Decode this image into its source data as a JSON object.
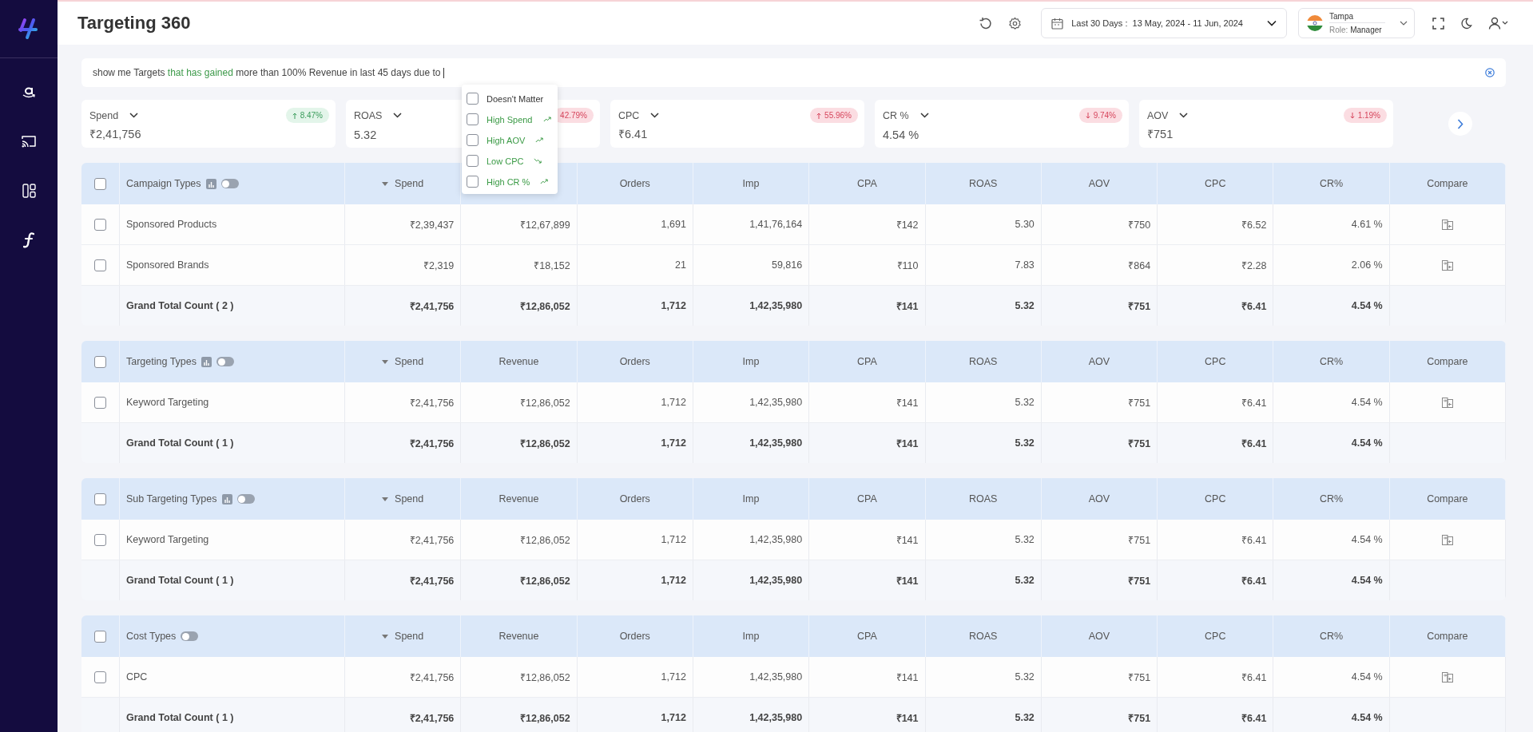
{
  "sidebar": {
    "items": [
      {
        "kind": "amazon"
      },
      {
        "kind": "cast"
      },
      {
        "kind": "dashboard"
      },
      {
        "kind": "function"
      }
    ]
  },
  "header": {
    "title": "Targeting 360",
    "date_range": "Last 30 Days :  13 May, 2024 - 11 Jun, 2024",
    "location": "Tampa",
    "role_label": "Role:",
    "role": "Manager"
  },
  "query": {
    "segments": [
      {
        "text": "show me Targets ",
        "highlight": false
      },
      {
        "text": "that has gained",
        "highlight": true
      },
      {
        "text": " more than 100% Revenue in last 45 days due to",
        "highlight": false
      }
    ]
  },
  "suggestions": [
    {
      "label": "Doesn't Matter",
      "checked": false
    },
    {
      "label": "High Spend",
      "checked": false,
      "rising": true
    },
    {
      "label": "High AOV",
      "checked": false,
      "rising": true
    },
    {
      "label": "Low CPC",
      "checked": false,
      "rising": false
    },
    {
      "label": "High CR %",
      "checked": false,
      "rising": true
    }
  ],
  "kpis": [
    {
      "label": "Spend",
      "value": "₹2,41,756",
      "change": "8.47%",
      "rising": true,
      "positive": true
    },
    {
      "label": "ROAS",
      "value": "5.32",
      "change": "42.79%",
      "positive": false
    },
    {
      "label": "CPC",
      "value": "₹6.41",
      "change": "55.96%",
      "rising": true,
      "positive": false
    },
    {
      "label": "CR %",
      "value": "4.54 %",
      "change": "9.74%",
      "rising": false,
      "positive": false
    },
    {
      "label": "AOV",
      "value": "₹751",
      "change": "1.19%",
      "rising": false,
      "positive": false
    }
  ],
  "tables": [
    {
      "title": "Campaign Types",
      "chart_icon": true,
      "toggle_on": false,
      "all_checked": false,
      "columns": [
        {
          "label": "Spend",
          "sorted": true
        },
        {},
        {
          "label": "Orders"
        },
        {
          "label": "Imp"
        },
        {
          "label": "CPA"
        },
        {
          "label": "ROAS"
        },
        {
          "label": "AOV"
        },
        {
          "label": "CPC"
        },
        {
          "label": "CR%"
        },
        {
          "label": "Compare"
        }
      ],
      "rows": [
        {
          "kind": "data",
          "checked": false,
          "name": "Sponsored Products",
          "values": [
            "₹2,39,437",
            "₹12,67,899",
            "1,691",
            "1,41,76,164",
            "₹142",
            "5.30",
            "₹750",
            "₹6.52",
            "4.61 %"
          ]
        },
        {
          "kind": "data",
          "checked": false,
          "name": "Sponsored Brands",
          "values": [
            "₹2,319",
            "₹18,152",
            "21",
            "59,816",
            "₹110",
            "7.83",
            "₹864",
            "₹2.28",
            "2.06 %"
          ]
        },
        {
          "kind": "total",
          "name": "Grand Total Count ( 2 )",
          "values": [
            "₹2,41,756",
            "₹12,86,052",
            "1,712",
            "1,42,35,980",
            "₹141",
            "5.32",
            "₹751",
            "₹6.41",
            "4.54 %"
          ]
        }
      ]
    },
    {
      "title": "Targeting Types",
      "chart_icon": true,
      "toggle_on": false,
      "all_checked": false,
      "columns": [
        {
          "label": "Spend",
          "sorted": true
        },
        {
          "label": "Revenue"
        },
        {
          "label": "Orders"
        },
        {
          "label": "Imp"
        },
        {
          "label": "CPA"
        },
        {
          "label": "ROAS"
        },
        {
          "label": "AOV"
        },
        {
          "label": "CPC"
        },
        {
          "label": "CR%"
        },
        {
          "label": "Compare"
        }
      ],
      "rows": [
        {
          "kind": "data",
          "checked": false,
          "name": "Keyword Targeting",
          "values": [
            "₹2,41,756",
            "₹12,86,052",
            "1,712",
            "1,42,35,980",
            "₹141",
            "5.32",
            "₹751",
            "₹6.41",
            "4.54 %"
          ]
        },
        {
          "kind": "total",
          "name": "Grand Total Count ( 1 )",
          "values": [
            "₹2,41,756",
            "₹12,86,052",
            "1,712",
            "1,42,35,980",
            "₹141",
            "5.32",
            "₹751",
            "₹6.41",
            "4.54 %"
          ]
        }
      ]
    },
    {
      "title": "Sub Targeting Types",
      "chart_icon": true,
      "toggle_on": false,
      "all_checked": false,
      "columns": [
        {
          "label": "Spend",
          "sorted": true
        },
        {
          "label": "Revenue"
        },
        {
          "label": "Orders"
        },
        {
          "label": "Imp"
        },
        {
          "label": "CPA"
        },
        {
          "label": "ROAS"
        },
        {
          "label": "AOV"
        },
        {
          "label": "CPC"
        },
        {
          "label": "CR%"
        },
        {
          "label": "Compare"
        }
      ],
      "rows": [
        {
          "kind": "data",
          "checked": false,
          "name": "Keyword Targeting",
          "values": [
            "₹2,41,756",
            "₹12,86,052",
            "1,712",
            "1,42,35,980",
            "₹141",
            "5.32",
            "₹751",
            "₹6.41",
            "4.54 %"
          ]
        },
        {
          "kind": "total",
          "name": "Grand Total Count ( 1 )",
          "values": [
            "₹2,41,756",
            "₹12,86,052",
            "1,712",
            "1,42,35,980",
            "₹141",
            "5.32",
            "₹751",
            "₹6.41",
            "4.54 %"
          ]
        }
      ]
    },
    {
      "title": "Cost Types",
      "chart_icon": false,
      "toggle_on": false,
      "all_checked": false,
      "columns": [
        {
          "label": "Spend",
          "sorted": true
        },
        {
          "label": "Revenue"
        },
        {
          "label": "Orders"
        },
        {
          "label": "Imp"
        },
        {
          "label": "CPA"
        },
        {
          "label": "ROAS"
        },
        {
          "label": "AOV"
        },
        {
          "label": "CPC"
        },
        {
          "label": "CR%"
        },
        {
          "label": "Compare"
        }
      ],
      "rows": [
        {
          "kind": "data",
          "checked": false,
          "name": "CPC",
          "values": [
            "₹2,41,756",
            "₹12,86,052",
            "1,712",
            "1,42,35,980",
            "₹141",
            "5.32",
            "₹751",
            "₹6.41",
            "4.54 %"
          ]
        },
        {
          "kind": "total",
          "name": "Grand Total Count ( 1 )",
          "values": [
            "₹2,41,756",
            "₹12,86,052",
            "1,712",
            "1,42,35,980",
            "₹141",
            "5.32",
            "₹751",
            "₹6.41",
            "4.54 %"
          ]
        }
      ]
    }
  ]
}
